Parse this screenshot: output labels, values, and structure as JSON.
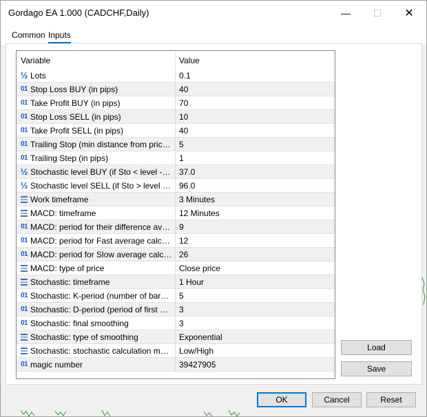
{
  "window": {
    "title": "Gordago EA 1.000 (CADCHF,Daily)"
  },
  "tabs": [
    {
      "label": "Common"
    },
    {
      "label": "Inputs"
    }
  ],
  "grid": {
    "headers": {
      "variable": "Variable",
      "value": "Value"
    },
    "rows": [
      {
        "icon": "half",
        "name": "Lots",
        "value": "0.1"
      },
      {
        "icon": "int",
        "name": "Stop Loss BUY (in pips)",
        "value": "40"
      },
      {
        "icon": "int",
        "name": "Take Profit BUY (in pips)",
        "value": "70"
      },
      {
        "icon": "int",
        "name": "Stop Loss SELL (in pips)",
        "value": "10"
      },
      {
        "icon": "int",
        "name": "Take Profit SELL (in pips)",
        "value": "40"
      },
      {
        "icon": "int",
        "name": "Trailing Stop (min distance from price to ...",
        "value": "5"
      },
      {
        "icon": "int",
        "name": "Trailing Step (in pips)",
        "value": "1"
      },
      {
        "icon": "half",
        "name": "Stochastic level BUY (if Sto < level -> si...",
        "value": "37.0"
      },
      {
        "icon": "half",
        "name": "Stochastic level SELL (if Sto > level -> si...",
        "value": "96.0"
      },
      {
        "icon": "enum",
        "name": "Work timeframe",
        "value": "3 Minutes"
      },
      {
        "icon": "enum",
        "name": "MACD: timeframe",
        "value": "12 Minutes"
      },
      {
        "icon": "int",
        "name": "MACD: period for their difference avera...",
        "value": "9"
      },
      {
        "icon": "int",
        "name": "MACD: period for Fast average calculation",
        "value": "12"
      },
      {
        "icon": "int",
        "name": "MACD: period for Slow average calculation",
        "value": "26"
      },
      {
        "icon": "enum",
        "name": "MACD: type of price",
        "value": "Close price"
      },
      {
        "icon": "enum",
        "name": "Stochastic: timeframe",
        "value": "1 Hour"
      },
      {
        "icon": "int",
        "name": "Stochastic: K-period (number of bars for...",
        "value": "5"
      },
      {
        "icon": "int",
        "name": "Stochastic: D-period (period of first smo...",
        "value": "3"
      },
      {
        "icon": "int",
        "name": "Stochastic: final smoothing",
        "value": "3"
      },
      {
        "icon": "enum",
        "name": "Stochastic: type of smoothing",
        "value": "Exponential"
      },
      {
        "icon": "enum",
        "name": "Stochastic: stochastic calculation method",
        "value": "Low/High"
      },
      {
        "icon": "int",
        "name": "magic number",
        "value": "39427905"
      }
    ]
  },
  "side_buttons": {
    "load": "Load",
    "save": "Save"
  },
  "footer_buttons": {
    "ok": "OK",
    "cancel": "Cancel",
    "reset": "Reset"
  },
  "colors": {
    "accent": "#0078d7",
    "icon_blue": "#1a56c9",
    "row_alt": "#f0f0f0"
  }
}
